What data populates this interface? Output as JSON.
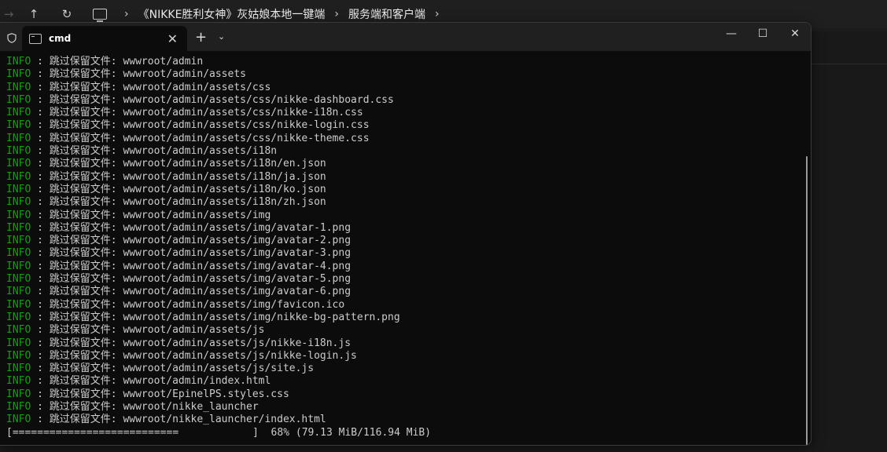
{
  "explorer": {
    "back": "→",
    "up": "↑",
    "refresh": "↻",
    "breadcrumbs": [
      "《NIKKE胜利女神》灰姑娘本地一键端",
      "服务端和客户端"
    ],
    "separator": "›"
  },
  "window": {
    "tab_title": "cmd",
    "tab_close": "✕",
    "new_tab": "+",
    "dropdown": "⌄",
    "minimize": "—",
    "maximize": "☐",
    "close": "✕"
  },
  "console": {
    "level": "INFO",
    "separator": " : ",
    "message": "跳过保留文件: ",
    "lines": [
      "wwwroot/admin",
      "wwwroot/admin/assets",
      "wwwroot/admin/assets/css",
      "wwwroot/admin/assets/css/nikke-dashboard.css",
      "wwwroot/admin/assets/css/nikke-i18n.css",
      "wwwroot/admin/assets/css/nikke-login.css",
      "wwwroot/admin/assets/css/nikke-theme.css",
      "wwwroot/admin/assets/i18n",
      "wwwroot/admin/assets/i18n/en.json",
      "wwwroot/admin/assets/i18n/ja.json",
      "wwwroot/admin/assets/i18n/ko.json",
      "wwwroot/admin/assets/i18n/zh.json",
      "wwwroot/admin/assets/img",
      "wwwroot/admin/assets/img/avatar-1.png",
      "wwwroot/admin/assets/img/avatar-2.png",
      "wwwroot/admin/assets/img/avatar-3.png",
      "wwwroot/admin/assets/img/avatar-4.png",
      "wwwroot/admin/assets/img/avatar-5.png",
      "wwwroot/admin/assets/img/avatar-6.png",
      "wwwroot/admin/assets/img/favicon.ico",
      "wwwroot/admin/assets/img/nikke-bg-pattern.png",
      "wwwroot/admin/assets/js",
      "wwwroot/admin/assets/js/nikke-i18n.js",
      "wwwroot/admin/assets/js/nikke-login.js",
      "wwwroot/admin/assets/js/site.js",
      "wwwroot/admin/index.html",
      "wwwroot/EpinelPS.styles.css",
      "wwwroot/nikke_launcher",
      "wwwroot/nikke_launcher/index.html"
    ],
    "progress_bar": "[===========================            ]",
    "progress_status": "  68% (79.13 MiB/116.94 MiB)",
    "progress_percent": 68
  }
}
